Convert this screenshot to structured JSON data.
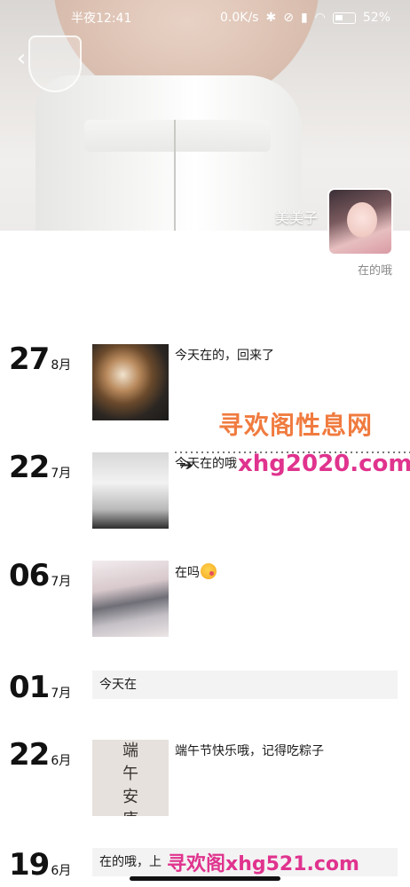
{
  "status_bar": {
    "time": "半夜12:41",
    "network_speed": "0.0K/s",
    "battery_percent": "52%"
  },
  "profile": {
    "name": "美美子",
    "status": "在的哦"
  },
  "timeline": [
    {
      "day": "27",
      "month": "8月",
      "text": "今天在的，回来了",
      "image": "coffee-photo"
    },
    {
      "day": "22",
      "month": "7月",
      "text": "今天在的哦",
      "image": "shoes-photo"
    },
    {
      "day": "06",
      "month": "7月",
      "text": "在吗",
      "emoji": "winking-kiss-emoji",
      "image": "dress-photo"
    },
    {
      "day": "01",
      "month": "7月",
      "text": "今天在"
    },
    {
      "day": "22",
      "month": "6月",
      "text": "端午节快乐哦，记得吃粽子",
      "image": "calligraphy-photo",
      "image_text": [
        "端",
        "午",
        "安",
        "康"
      ]
    },
    {
      "day": "19",
      "month": "6月",
      "text": "在的哦，上"
    }
  ],
  "watermarks": {
    "line1": "寻欢阁性息网",
    "line2": "xhg2020.com",
    "line3": "寻欢阁xhg521.com"
  }
}
